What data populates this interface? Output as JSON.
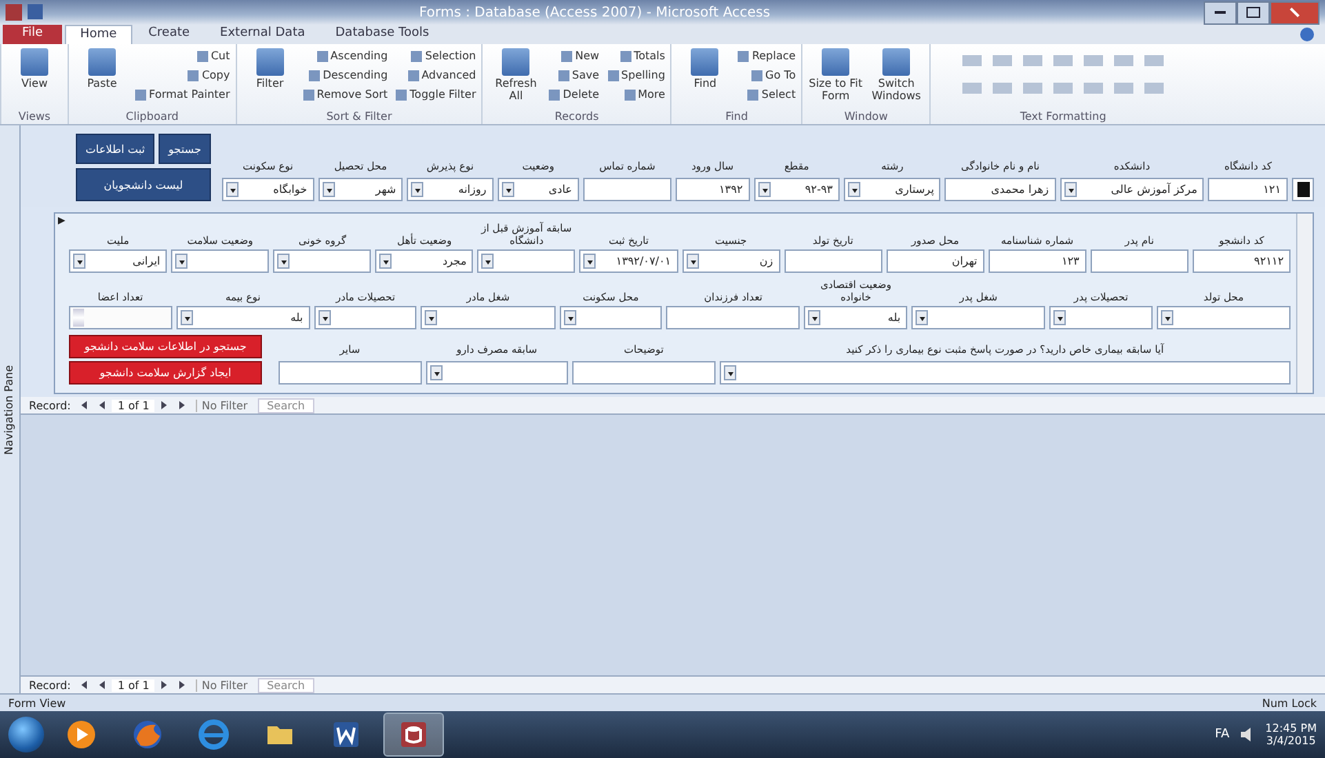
{
  "window": {
    "title": "Forms : Database (Access 2007) - Microsoft Access"
  },
  "ribbon": {
    "tabs": [
      {
        "label": "Database Tools",
        "selected": false,
        "kind": "tab"
      },
      {
        "label": "External Data",
        "selected": false,
        "kind": "tab"
      },
      {
        "label": "Create",
        "selected": false,
        "kind": "tab"
      },
      {
        "label": "Home",
        "selected": true,
        "kind": "tab"
      },
      {
        "label": "File",
        "selected": false,
        "kind": "file"
      }
    ],
    "groups": [
      {
        "label": "Text Formatting"
      },
      {
        "label": "Window",
        "large": [
          "Switch Windows",
          "Size to Fit Form"
        ]
      },
      {
        "label": "Find",
        "large": [
          "Find"
        ],
        "small": [
          "Replace",
          "Go To",
          "Select"
        ]
      },
      {
        "label": "Records",
        "large": [
          "Refresh All"
        ],
        "small": [
          "Totals",
          "New",
          "Spelling",
          "Save",
          "More",
          "Delete"
        ]
      },
      {
        "label": "Sort & Filter",
        "large": [
          "Filter"
        ],
        "small": [
          "Selection",
          "Ascending",
          "Advanced",
          "Descending",
          "Toggle Filter",
          "Remove Sort"
        ]
      },
      {
        "label": "Clipboard",
        "large": [
          "Paste"
        ],
        "small": [
          "Cut",
          "Copy",
          "Format Painter"
        ]
      },
      {
        "label": "Views",
        "large": [
          "View"
        ]
      }
    ]
  },
  "navigation_pane": {
    "label": "Navigation Pane"
  },
  "header": {
    "buttons": [
      {
        "label": "ثبت اطلاعات"
      },
      {
        "label": "جستجو"
      },
      {
        "label": "لیست دانشجویان"
      }
    ],
    "fields": [
      {
        "kind": "photo"
      },
      {
        "label": "کد دانشگاه",
        "value": "۱۲۱",
        "kind": "text"
      },
      {
        "label": "دانشکده",
        "value": "مرکز آموزش عالی",
        "kind": "combo"
      },
      {
        "label": "نام و نام خانوادگی",
        "value": "زهرا محمدی",
        "kind": "text"
      },
      {
        "label": "رشته",
        "value": "پرستاری",
        "kind": "combo"
      },
      {
        "label": "مقطع",
        "value": "۹۲-۹۳",
        "kind": "combo"
      },
      {
        "label": "سال ورود",
        "value": "۱۳۹۲",
        "kind": "text"
      },
      {
        "label": "شماره تماس",
        "kind": "text"
      },
      {
        "label": "وضعیت",
        "value": "عادی",
        "kind": "combo"
      },
      {
        "label": "نوع پذیرش",
        "value": "روزانه",
        "kind": "combo"
      },
      {
        "label": "محل تحصیل",
        "value": "شهر",
        "kind": "combo"
      },
      {
        "label": "نوع سکونت",
        "value": "خوابگاه",
        "kind": "combo"
      }
    ]
  },
  "subform": {
    "record_selector": "▶",
    "sections": [
      {
        "fields": [
          {
            "label": "کد دانشجو",
            "value": "۹۲۱۱۲",
            "kind": "text"
          },
          {
            "label": "نام پدر",
            "kind": "text"
          },
          {
            "label": "شماره شناسنامه",
            "value": "۱۲۳",
            "kind": "text"
          },
          {
            "label": "محل صدور",
            "value": "تهران",
            "kind": "text"
          },
          {
            "label": "تاریخ تولد",
            "kind": "text"
          },
          {
            "label": "جنسیت",
            "value": "زن",
            "kind": "combo"
          },
          {
            "label": "تاریخ ثبت",
            "value": "۱۳۹۲/۰۷/۰۱",
            "kind": "combo"
          },
          {
            "label": "سابقه آموزش قبل از دانشگاه",
            "kind": "combo"
          },
          {
            "label": "وضعیت تأهل",
            "value": "مجرد",
            "kind": "combo"
          },
          {
            "label": "گروه خونی",
            "kind": "combo"
          },
          {
            "label": "وضعیت سلامت",
            "kind": "combo"
          },
          {
            "label": "ملیت",
            "value": "ایرانی",
            "kind": "combo"
          }
        ]
      },
      {
        "fields": [
          {
            "label": "محل تولد",
            "kind": "combo"
          },
          {
            "label": "تحصیلات پدر",
            "kind": "combo"
          },
          {
            "label": "شغل پدر",
            "kind": "combo"
          },
          {
            "label": "وضعیت اقتصادی خانواده",
            "value": "بله",
            "kind": "combo"
          },
          {
            "label": "تعداد فرزندان",
            "kind": "text"
          },
          {
            "label": "محل سکونت",
            "kind": "combo"
          },
          {
            "label": "شغل مادر",
            "kind": "combo"
          },
          {
            "label": "تحصیلات مادر",
            "kind": "combo"
          },
          {
            "label": "نوع بیمه",
            "value": "بله",
            "kind": "combo"
          },
          {
            "label": "تعداد اعضا",
            "kind": "spin"
          }
        ]
      },
      {
        "fields": [
          {
            "label": "آیا سابقه بیماری خاص دارید؟ در صورت پاسخ مثبت نوع بیماری را ذکر کنید",
            "kind": "combo"
          },
          {
            "label": "توضیحات",
            "kind": "text"
          },
          {
            "label": "سابقه مصرف دارو",
            "kind": "combo"
          },
          {
            "label": "سایر",
            "kind": "text"
          }
        ]
      }
    ],
    "buttons": [
      {
        "label": "جستجو در اطلاعات سلامت دانشجو"
      },
      {
        "label": "ایجاد گزارش سلامت دانشجو"
      }
    ]
  },
  "record_navs": [
    {
      "label": "Record:",
      "position": "1 of 1",
      "filter": "No Filter",
      "search": "Search"
    },
    {
      "label": "Record:",
      "position": "1 of 1",
      "filter": "No Filter",
      "search": "Search"
    }
  ],
  "status_bar": {
    "left": "Form View",
    "right": "Num Lock"
  },
  "taskbar": {
    "apps": [
      {
        "kind": "media",
        "selected": false
      },
      {
        "kind": "firefox",
        "selected": false
      },
      {
        "kind": "ie",
        "selected": false
      },
      {
        "kind": "folder",
        "selected": false
      },
      {
        "kind": "word",
        "selected": false
      },
      {
        "kind": "access",
        "selected": true
      }
    ],
    "language": "FA",
    "clock": "12:45 PM",
    "date": "3/4/2015"
  }
}
